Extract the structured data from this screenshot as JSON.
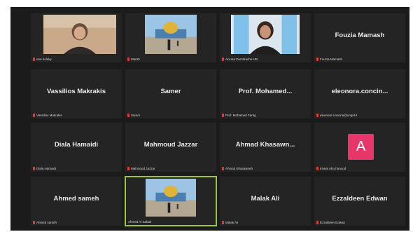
{
  "participants": [
    {
      "name": "",
      "label": "ena bolaky",
      "type": "video"
    },
    {
      "name": "",
      "label": "Marah",
      "type": "video"
    },
    {
      "name": "",
      "label": "Ancuța Dumitrache-UB",
      "type": "video"
    },
    {
      "name": "Fouzia Mamash",
      "label": "Fouzia Mamash",
      "type": "name"
    },
    {
      "name": "Vassilios Makrakis",
      "label": "Vassilios Makrakis",
      "type": "name"
    },
    {
      "name": "Samer",
      "label": "Samer",
      "type": "name"
    },
    {
      "name": "Prof. Mohamed...",
      "label": "Prof. Mohamed Farag",
      "type": "name"
    },
    {
      "name": "eleonora.concin...",
      "label": "eleonora.concina@unipd.it",
      "type": "name"
    },
    {
      "name": "Diala Hamaidi",
      "label": "Diala Hamaidi",
      "type": "name"
    },
    {
      "name": "Mahmoud Jazzar",
      "label": "Mahmoud Jazzar",
      "type": "name"
    },
    {
      "name": "Ahmad  Khasawn...",
      "label": "Ahmad Khasawneh",
      "type": "name"
    },
    {
      "name": "",
      "label": "Imwat Abu hanoud",
      "type": "avatar",
      "avatar_letter": "A"
    },
    {
      "name": "Ahmed sameh",
      "label": "Ahmed sameh",
      "type": "name"
    },
    {
      "name": "",
      "label": "Ahmed Al Safadi",
      "type": "video",
      "speaking": true
    },
    {
      "name": "Malak Ali",
      "label": "Malak Ali",
      "type": "name"
    },
    {
      "name": "Ezzaldeen Edwan",
      "label": "Ezzaldeen Edwan",
      "type": "name"
    }
  ],
  "colors": {
    "background": "#1b1b1b",
    "tile": "#242424",
    "avatar": "#e8366b",
    "active_speaker": "#9bc53d",
    "muted": "#e53935"
  }
}
